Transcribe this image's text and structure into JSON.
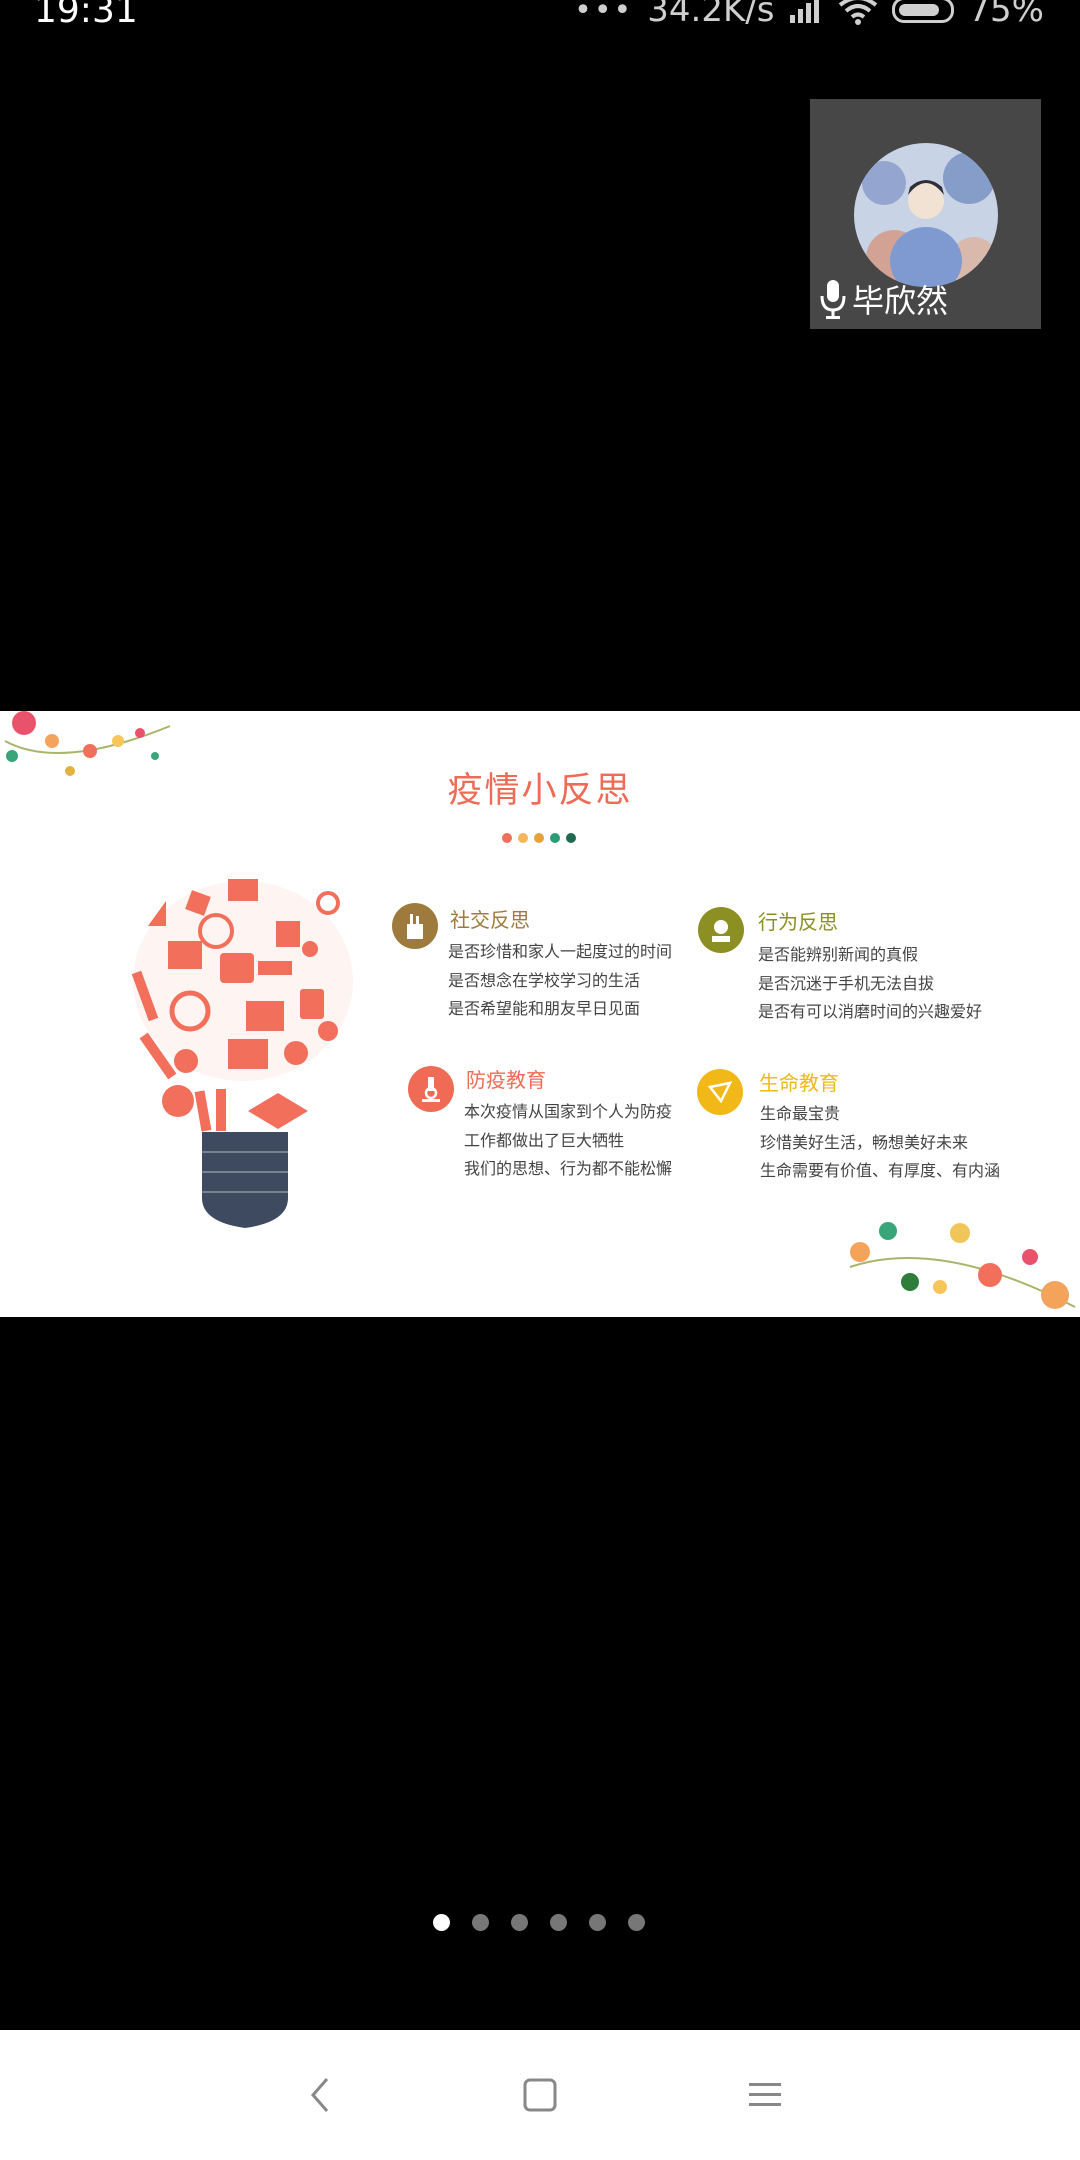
{
  "status_bar": {
    "time": "19:31",
    "dots": "•••",
    "speed": "34.2K/s",
    "battery": "75%"
  },
  "participant": {
    "name": "毕欣然"
  },
  "slide": {
    "title": "疫情小反思",
    "dot_colors": [
      "#f26f5c",
      "#f5b55b",
      "#e7a23a",
      "#2a9d74",
      "#1e6b52"
    ],
    "sections": [
      {
        "title": "社交反思",
        "color": "#9e7b3c",
        "lines": [
          "是否珍惜和家人一起度过的时间",
          "是否想念在学校学习的生活",
          "是否希望能和朋友早日见面"
        ]
      },
      {
        "title": "行为反思",
        "color": "#8c8f22",
        "lines": [
          "是否能辨别新闻的真假",
          "是否沉迷于手机无法自拔",
          "是否有可以消磨时间的兴趣爱好"
        ]
      },
      {
        "title": "防疫教育",
        "color": "#ef6b55",
        "lines": [
          "本次疫情从国家到个人为防疫",
          "工作都做出了巨大牺牲",
          "我们的思想、行为都不能松懈"
        ]
      },
      {
        "title": "生命教育",
        "color": "#f2b817",
        "lines": [
          "生命最宝贵",
          "珍惜美好生活，畅想美好未来",
          "生命需要有价值、有厚度、有内涵"
        ]
      }
    ]
  },
  "pager": {
    "count": 6,
    "active_index": 0
  }
}
